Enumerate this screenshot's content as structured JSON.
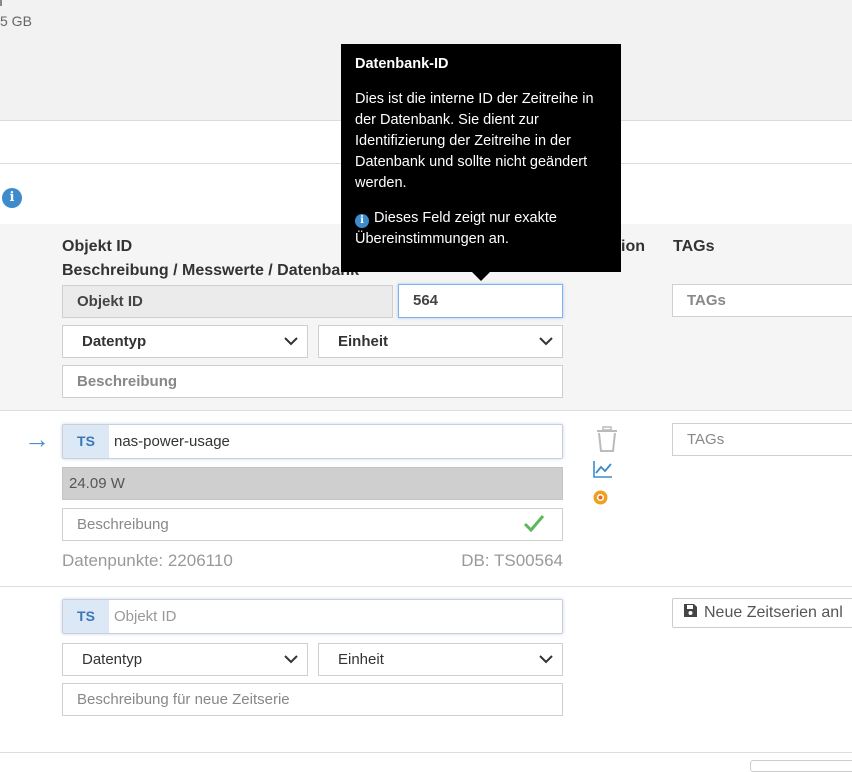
{
  "top": {
    "disk_text": "5 GB"
  },
  "headers": {
    "objekt_id": "Objekt ID",
    "beschreibung": "Beschreibung / Messwerte / Datenbank",
    "aktion_partial": "ion",
    "tags": "TAGs"
  },
  "filter": {
    "objekt_id_label": "Objekt ID",
    "db_id_value": "564",
    "datentyp": "Datentyp",
    "einheit": "Einheit",
    "beschreibung_placeholder": "Beschreibung",
    "tags_placeholder": "TAGs"
  },
  "timeseries": {
    "badge": "TS",
    "name": "nas-power-usage",
    "current_value": "24.09 W",
    "beschreibung_placeholder": "Beschreibung",
    "datenpunkte": "Datenpunkte: 2206110",
    "db_id": "DB: TS00564",
    "tags_placeholder": "TAGs"
  },
  "new_series": {
    "badge": "TS",
    "objekt_id_placeholder": "Objekt ID",
    "datentyp": "Datentyp",
    "einheit": "Einheit",
    "beschreibung_placeholder": "Beschreibung für neue Zeitserie",
    "save_button": "Neue Zeitserien anl"
  },
  "tooltip": {
    "title": "Datenbank-ID",
    "body": "Dies ist die interne ID der Zeitreihe in der Datenbank. Sie dient zur Identifizierung der Zeitreihe in der Datenbank und sollte nicht geändert werden.",
    "note": "Dieses Feld zeigt nur exakte Übereinstimmungen an."
  },
  "icons": {
    "info": "info-icon",
    "arrow": "arrow-right-icon",
    "trash": "trash-icon",
    "chart": "chart-line-icon",
    "grafana": "grafana-icon",
    "check": "check-icon",
    "save": "floppy-disk-icon",
    "chevron": "chevron-down-icon"
  },
  "colors": {
    "accent": "#3d8bcd",
    "success": "#5cb85c",
    "grafana": "#f0a020"
  }
}
